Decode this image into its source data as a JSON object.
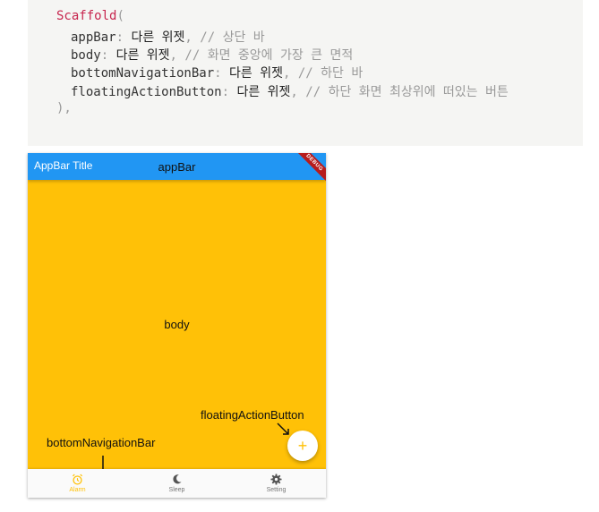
{
  "code": {
    "line1_name": "Scaffold",
    "line1_open": "(",
    "appbar_prop": "appBar",
    "appbar_value": "다른 위젯",
    "appbar_comment": "// 상단 바",
    "body_prop": "body",
    "body_value": "다른 위젯",
    "body_comment": "// 화면 중앙에 가장 큰 면적",
    "bnb_prop": "bottomNavigationBar",
    "bnb_value": "다른 위젯",
    "bnb_comment": "// 하단 바",
    "fab_prop": "floatingActionButton",
    "fab_value": "다른 위젯",
    "fab_comment": "// 하단 화면 최상위에 떠있는 버튼",
    "colon": ":",
    "comma": ",",
    "close": "),"
  },
  "phone": {
    "appbar_title": "AppBar Title",
    "appbar_label": "appBar",
    "debug_banner": "DEBUG",
    "body_label": "body",
    "fab_label": "floatingActionButton",
    "fab_symbol": "+",
    "bnb_label": "bottomNavigationBar",
    "nav_items": [
      {
        "label": "Alarm",
        "icon": "alarm-icon",
        "active": true
      },
      {
        "label": "Sleep",
        "icon": "moon-icon",
        "active": false
      },
      {
        "label": "Setting",
        "icon": "gear-icon",
        "active": false
      }
    ]
  },
  "colors": {
    "appbar": "#2196F3",
    "body": "#FFC107",
    "active_nav": "#FFC107",
    "inactive_nav": "#757575",
    "code_keyword": "#c7254e"
  }
}
